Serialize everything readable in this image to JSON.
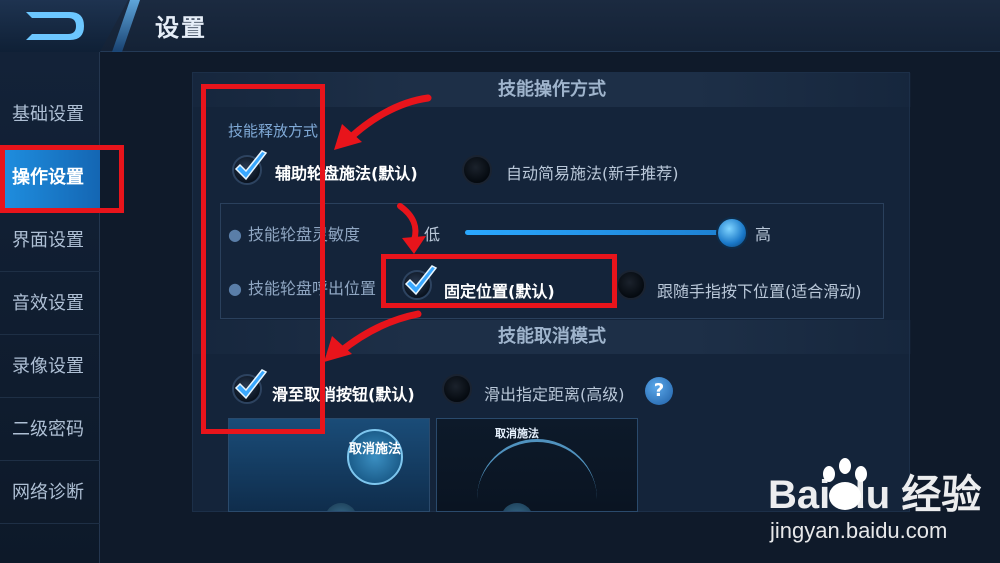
{
  "header": {
    "title": "设置",
    "back_icon": "back-arrow-icon"
  },
  "sidebar": {
    "items": [
      {
        "label": "基础设置",
        "active": false
      },
      {
        "label": "操作设置",
        "active": true
      },
      {
        "label": "界面设置",
        "active": false
      },
      {
        "label": "音效设置",
        "active": false
      },
      {
        "label": "录像设置",
        "active": false
      },
      {
        "label": "二级密码",
        "active": false
      },
      {
        "label": "网络诊断",
        "active": false
      }
    ]
  },
  "skill_operation": {
    "section_title": "技能操作方式",
    "release_label": "技能释放方式",
    "option_assist": "辅助轮盘施法(默认)",
    "option_simple": "自动简易施法(新手推荐)",
    "sensitivity_label": "技能轮盘灵敏度",
    "sensitivity_low": "低",
    "sensitivity_high": "高",
    "sensitivity_value": 0.97,
    "call_position_label": "技能轮盘呼出位置",
    "option_fixed": "固定位置(默认)",
    "option_follow": "跟随手指按下位置(适合滑动)"
  },
  "skill_cancel": {
    "section_title": "技能取消模式",
    "option_slide_button": "滑至取消按钮(默认)",
    "option_slide_distance": "滑出指定距离(高级)",
    "help_label": "?",
    "preview_a_text": "取消施法",
    "preview_b_text": "取消施法"
  },
  "watermark": {
    "logo": "Bai du 经验",
    "url": "jingyan.baidu.com"
  },
  "colors": {
    "accent": "#1f8fe0",
    "annotation_red": "#e8141b"
  }
}
